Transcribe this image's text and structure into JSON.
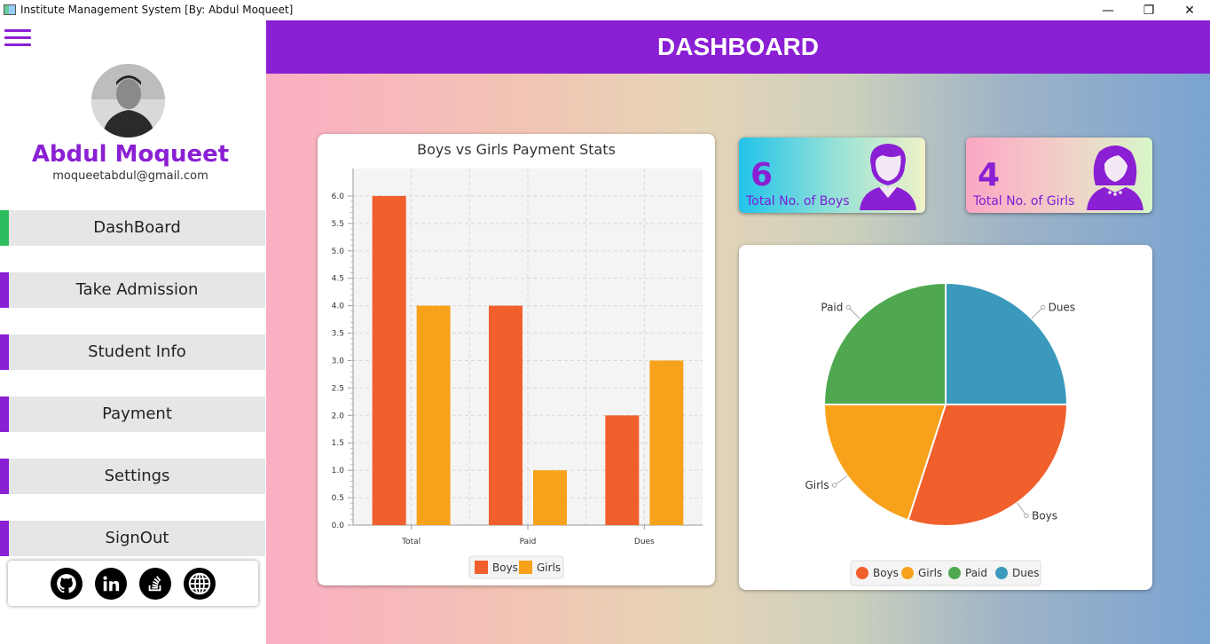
{
  "window": {
    "title": "Institute Management System [By: Abdul Moqueet]",
    "minimize_glyph": "—",
    "maximize_glyph": "❐",
    "close_glyph": "✕"
  },
  "sidebar": {
    "user_name": "Abdul Moqueet",
    "user_email": "moqueetabdul@gmail.com",
    "items": [
      {
        "label": "DashBoard",
        "active": true
      },
      {
        "label": "Take Admission",
        "active": false
      },
      {
        "label": "Student Info",
        "active": false
      },
      {
        "label": "Payment",
        "active": false
      },
      {
        "label": "Settings",
        "active": false
      },
      {
        "label": "SignOut",
        "active": false
      }
    ],
    "social": [
      "github-icon",
      "linkedin-icon",
      "stackoverflow-icon",
      "globe-icon"
    ]
  },
  "header": {
    "title": "DASHBOARD"
  },
  "stats": {
    "boys": {
      "value": "6",
      "label": "Total No. of Boys"
    },
    "girls": {
      "value": "4",
      "label": "Total No. of Girls"
    }
  },
  "colors": {
    "accent": "#8a1fd4",
    "active": "#2ebd5e",
    "boys": "#f05f2c",
    "girls": "#f8a21c",
    "paid": "#4fa84f",
    "dues": "#3b9abb"
  },
  "chart_data": [
    {
      "type": "bar",
      "title": "Boys vs Girls Payment Stats",
      "categories": [
        "Total",
        "Paid",
        "Dues"
      ],
      "series": [
        {
          "name": "Boys",
          "values": [
            6,
            4,
            2
          ]
        },
        {
          "name": "Girls",
          "values": [
            4,
            1,
            3
          ]
        }
      ],
      "ylim": [
        0,
        6.5
      ],
      "yticks": [
        "0.0",
        "0.5",
        "1.0",
        "1.5",
        "2.0",
        "2.5",
        "3.0",
        "3.5",
        "4.0",
        "4.5",
        "5.0",
        "5.5",
        "6.0"
      ],
      "grid": true,
      "legend": "bottom"
    },
    {
      "type": "pie",
      "labels": [
        "Boys",
        "Girls",
        "Paid",
        "Dues"
      ],
      "values": [
        6,
        4,
        5,
        5
      ],
      "legend": "bottom"
    }
  ]
}
